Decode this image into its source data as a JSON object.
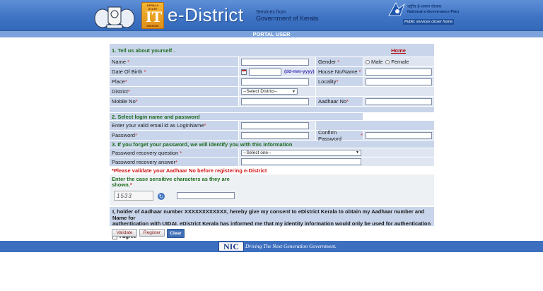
{
  "header": {
    "mission_badge_top": "KERALA STATE",
    "mission_badge_mid": "IT",
    "mission_badge_bottom": "MISSION",
    "brand": "e-District",
    "services_line1": "Services from",
    "services_line2": "Government of Kerala",
    "negp_hindi": "राष्ट्रीय ई-शासन योजना",
    "negp_name": "National e-Governance Plan",
    "negp_tagline": "Public services closer home"
  },
  "portal_bar": "PORTAL USER",
  "form": {
    "section1": "1. Tell us about yourself .",
    "home_link": "Home",
    "name_label": "Name",
    "gender_label": "Gender",
    "gender_male": "Male",
    "gender_female": "Female",
    "dob_label": "Date Of Birth",
    "dob_hint": "(dd-mm-yyyy)",
    "house_label": "House No/Name",
    "place_label": "Place",
    "locality_label": "Locality",
    "district_label": "District",
    "district_select": "--Select District--",
    "mobile_label": "Mobile No",
    "aadhaar_label": "Aadhaar No",
    "section2": "2. Select login name and password",
    "email_label": "Enter your valid email id as LoginName",
    "password_label": "Password",
    "confirm_password_label": "Confirm Password",
    "section3": "3. If you forget your password, we will identify you with this information",
    "recovery_q_label": "Password recovery question",
    "recovery_q_select": "--Select one--",
    "recovery_a_label": "Password recovery answer",
    "aadhaar_warning": "*Please validate your Aadhaar No before registering e-District",
    "captcha_prompt_line1": "Enter the case sensitive characters as they are",
    "captcha_prompt_line2": "shown.",
    "captcha_text": "1533",
    "consent_line1": "I, holder of Aadhaar number XXXXXXXXXXXX, hereby give my consent to eDistrict Kerala to obtain my Aadhaar number and Name for",
    "consent_line2": "authentication with UIDAI. eDistrict Kerala has informed me that my identity information would only be used for authentication purpose.",
    "agree_label": "I agree",
    "validate_button": "Validate",
    "register_button": "Register",
    "clear_button": "Clear"
  },
  "footer": {
    "nic": "NIC",
    "tagline": "Driving The Next Generation Government."
  }
}
